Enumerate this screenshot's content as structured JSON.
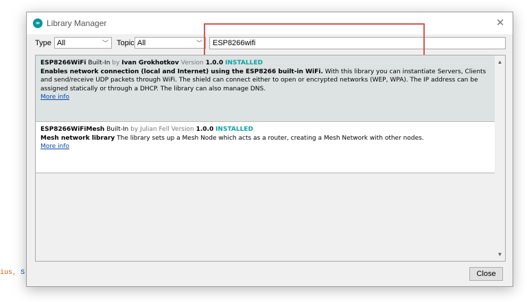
{
  "background": {
    "code_text": "ius, ",
    "code_text_2": "S"
  },
  "window": {
    "title": "Library Manager",
    "icon_text": "∞"
  },
  "filters": {
    "type_label": "Type",
    "type_value": "All",
    "topic_label": "Topic",
    "topic_value": "All",
    "search_value": "ESP8266wifi"
  },
  "libraries": [
    {
      "name": "ESP8266WiFi",
      "builtin": "Built-In",
      "by_word": "by",
      "author": "Ivan Grokhotkov",
      "version_label": "Version",
      "version": "1.0.0",
      "status": "INSTALLED",
      "summary": "Enables network connection (local and Internet) using the ESP8266 built-in WiFi.",
      "description": "With this library you can instantiate Servers, Clients and send/receive UDP packets through WiFi. The shield can connect either to open or encrypted networks (WEP, WPA). The IP address can be assigned statically or through a DHCP. The library can also manage DNS.",
      "more_info": "More info"
    },
    {
      "name": "ESP8266WiFiMesh",
      "builtin": "Built-In",
      "by_word": "by",
      "author": "Julian Fell",
      "version_label": "Version",
      "version": "1.0.0",
      "status": "INSTALLED",
      "summary": "Mesh network library",
      "description": "The library sets up a Mesh Node which acts as a router, creating a Mesh Network with other nodes.",
      "more_info": "More info"
    }
  ],
  "buttons": {
    "close": "Close"
  },
  "colors": {
    "highlight": "#d9534f",
    "installed": "#0ca1a6",
    "selected_row": "#dde3e3"
  }
}
